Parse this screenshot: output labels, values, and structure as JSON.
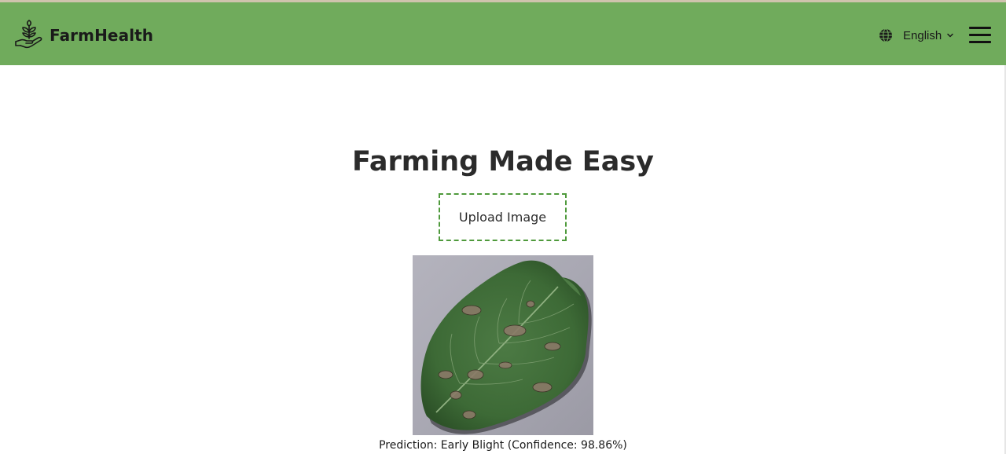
{
  "app": {
    "brand_name": "FarmHealth",
    "brand_color": "#70ab5c"
  },
  "header": {
    "language": {
      "selected": "English",
      "icon": "globe-icon",
      "dropdown_icon": "chevron-down-icon"
    },
    "menu_icon": "hamburger-menu-icon",
    "logo_icon": "plant-in-hand-icon"
  },
  "main": {
    "headline": "Farming Made Easy",
    "upload_button_label": "Upload Image",
    "uploaded_image": {
      "alt": "Potato leaf",
      "icon": "leaf-photo"
    },
    "prediction_text": "Prediction: Early Blight (Confidence: 98.86%)"
  },
  "colors": {
    "navbar_bg": "#70ab5c",
    "upload_border": "#4f9a3c",
    "text_dark": "#2b2b2b"
  }
}
